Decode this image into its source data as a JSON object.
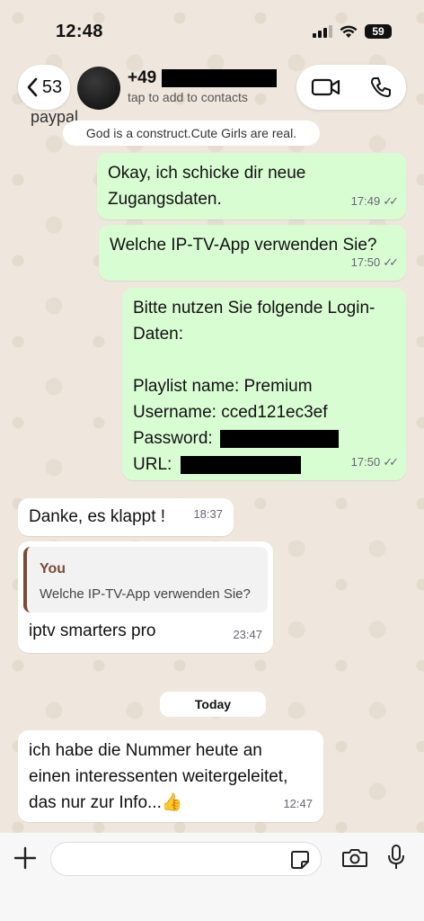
{
  "status": {
    "time": "12:48",
    "battery": "59"
  },
  "header": {
    "back_count": "53",
    "contact_prefix": "+49",
    "contact_sub": "tap to add to contacts"
  },
  "chat": {
    "cut_message_fragment": "paypal",
    "system_notice": "God is a construct.Cute Girls are real.",
    "messages": [
      {
        "text": "Okay, ich schicke dir neue\nZugangsdaten.",
        "time": "17:49"
      },
      {
        "text": "Welche IP-TV-App verwenden Sie?",
        "time": "17:50"
      },
      {
        "line1": "Bitte nutzen Sie folgende Login-",
        "line2": "Daten:",
        "playlist": "Playlist name: Premium",
        "username": "Username: cced121ec3ef",
        "password_label": "Password:",
        "url_label": "URL:",
        "time": "17:50"
      },
      {
        "text": "Danke, es klappt !",
        "time": "18:37"
      },
      {
        "quote_author": "You",
        "quote_text": "Welche IP-TV-App verwenden Sie?",
        "text": "iptv smarters pro",
        "time": "23:47"
      },
      {
        "text": "ich habe die Nummer heute an\neinen interessenten weitergeleitet,\ndas nur zur Info...👍",
        "time": "12:47"
      }
    ],
    "date_separator": "Today"
  },
  "colors": {
    "outgoing": "#d9fdd3",
    "incoming": "#ffffff",
    "quote_accent": "#7a4b35"
  },
  "icons": [
    "back-chevron-icon",
    "video-call-icon",
    "phone-icon",
    "plus-icon",
    "sticker-icon",
    "camera-icon",
    "mic-icon",
    "double-check-icon"
  ]
}
